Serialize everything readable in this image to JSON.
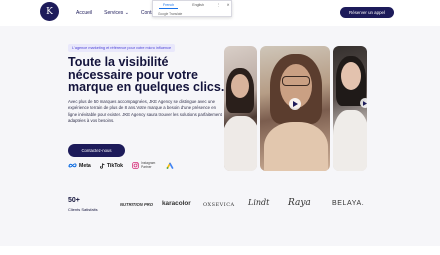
{
  "header": {
    "logo_letter": "K",
    "nav": {
      "accueil": "Accueil",
      "services": "Services",
      "contact": "Contact"
    },
    "cta": "Réserver un appel"
  },
  "translate_popup": {
    "tab_french": "French",
    "tab_english": "English",
    "attribution": "Google Translate"
  },
  "hero": {
    "badge": "L'agence marketing et référence pour votre micro influence",
    "headline": "Toute la visibilité nécessaire pour votre marque en quelques clics.",
    "description": "Avec plus de 50 marques accompagnées, JKE Agency se distingue avec une expérience terrain de plus de 8 ans.Votre marque a besoin d'une présence en ligne inévitable pour exister. JKE Agency saura trouver les solutions parfaitement adaptées à vos besoins.",
    "contact_button": "Contactez-nous",
    "partners": [
      {
        "name": "Meta",
        "icon": "meta-icon"
      },
      {
        "name": "TikTok",
        "icon": "tiktok-icon"
      },
      {
        "name": "Instagram Partner",
        "icon": "instagram-icon"
      },
      {
        "name": "",
        "icon": "google-ads-icon"
      }
    ]
  },
  "stats": {
    "number": "50+",
    "label": "Clients Satisfaits"
  },
  "client_logos": [
    "NUTRITION PRO",
    "karacolor",
    "OXSEVICA",
    "Lindt",
    "Raya",
    "BELAYA."
  ],
  "colors": {
    "primary": "#1d1b5a",
    "background": "#f6f6f9",
    "badge_bg": "#e9e8fb",
    "badge_text": "#4a3fd6"
  }
}
